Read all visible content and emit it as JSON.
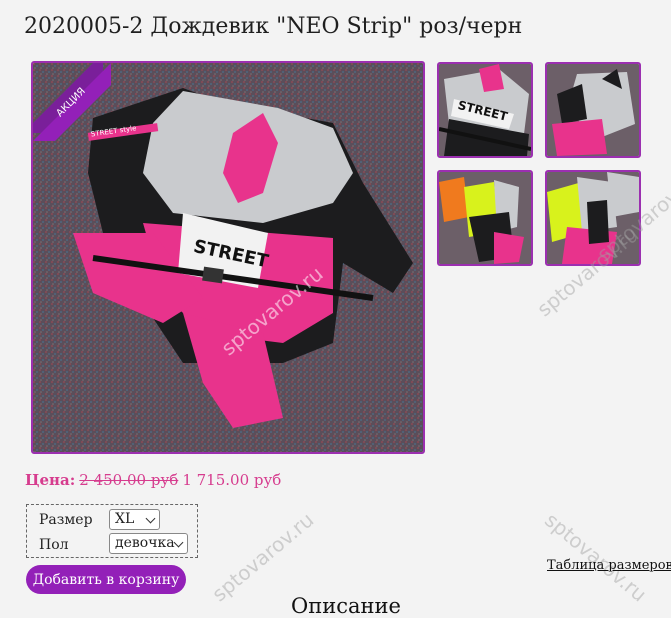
{
  "product": {
    "title": "2020005-2 Дождевик \"NEO Strip\" роз/черн",
    "badge": "АКЦИЯ",
    "photo_print": {
      "street": "STREET",
      "style": "STREET style",
      "watermark": "sptovarov.ru"
    }
  },
  "price": {
    "label": "Цена:",
    "old": "2 450.00 руб",
    "new": "1 715.00 руб"
  },
  "options": {
    "size_label": "Размер",
    "size_value": "XL",
    "gender_label": "Пол",
    "gender_value": "девочка"
  },
  "actions": {
    "add_to_cart": "Добавить в корзину",
    "size_table": "Таблица размеров"
  },
  "section": {
    "description_title": "Описание"
  },
  "watermarks": [
    "sptovarov.ru",
    "sptovarov.ru",
    "sptovarov.ru",
    "sptovarov.ru"
  ],
  "colors": {
    "accent": "#9320b8",
    "price": "#d63c8e",
    "frame": "#9b2fb0",
    "pink": "#e8338c",
    "grey": "#c9cbce",
    "black": "#1c1c1e"
  }
}
